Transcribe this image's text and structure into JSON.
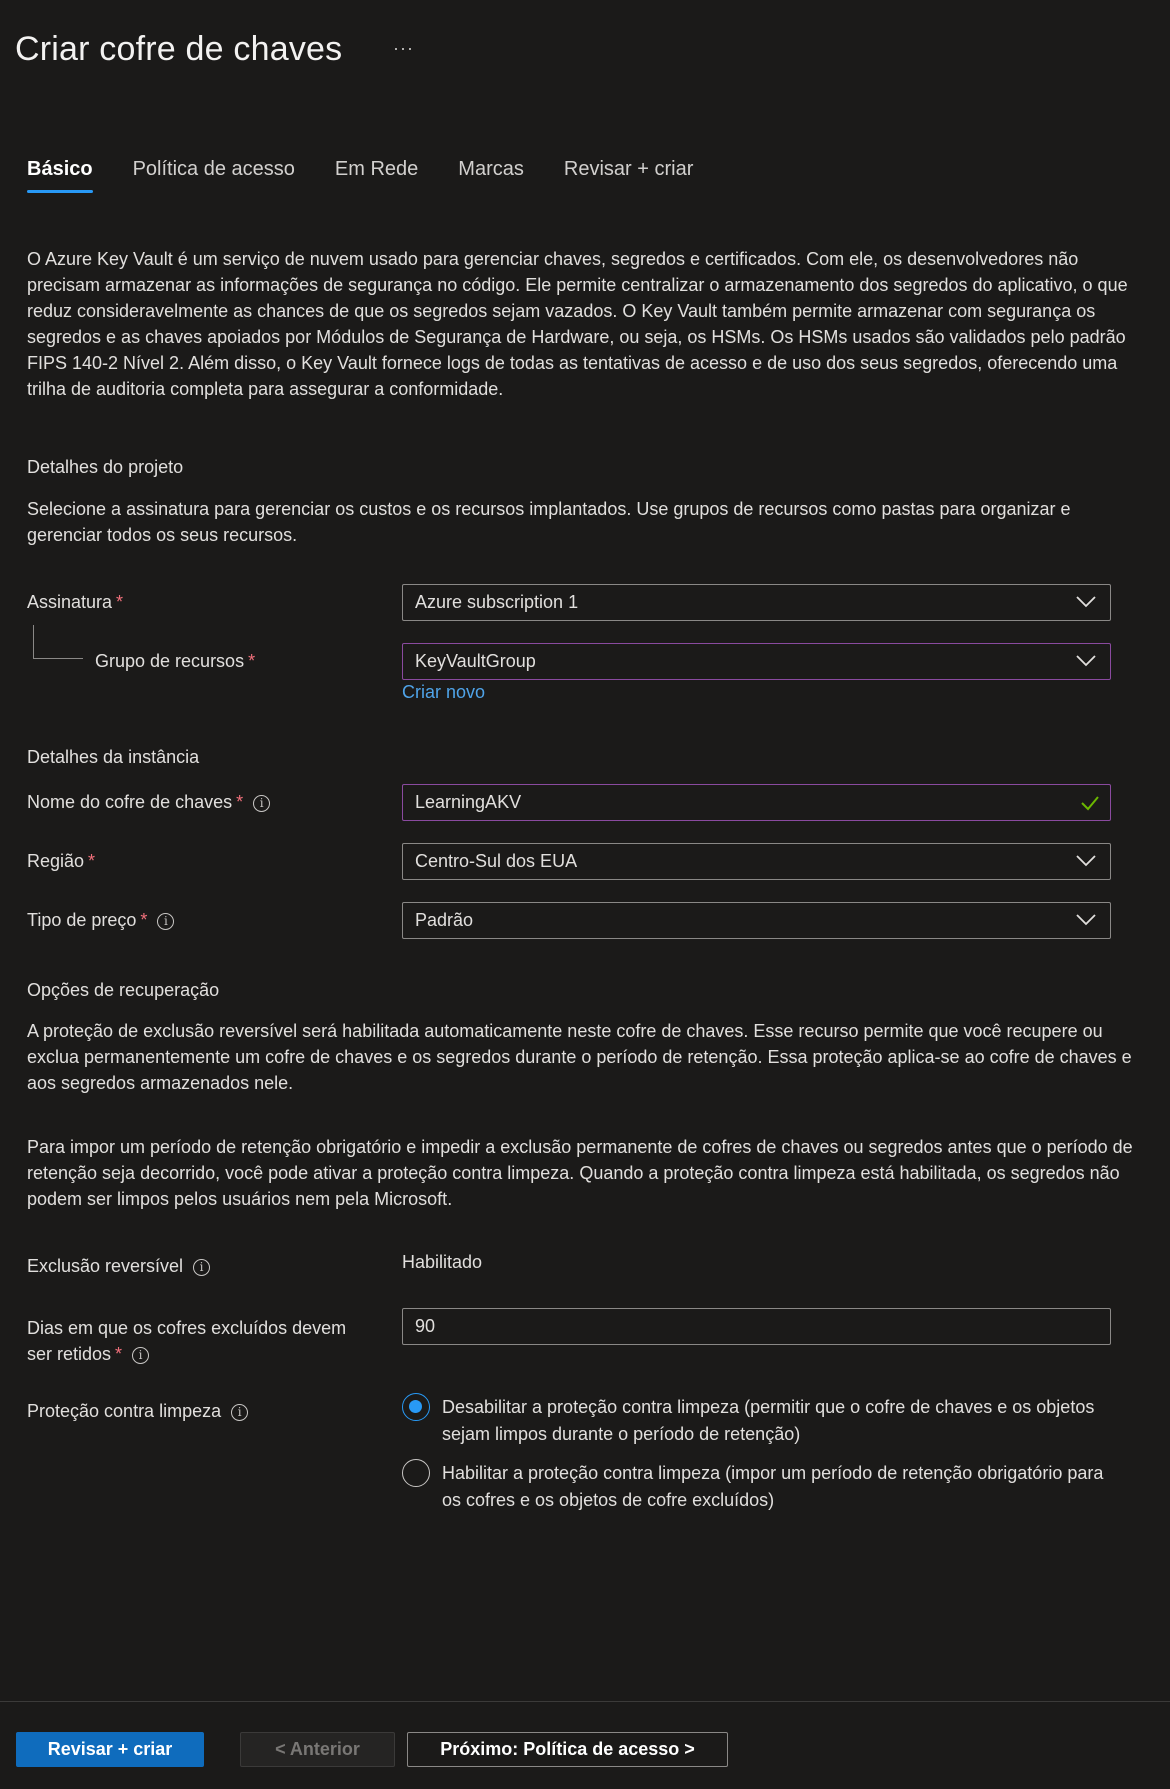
{
  "header": {
    "title": "Criar cofre de chaves",
    "more_icon": "ellipsis-icon"
  },
  "tabs": [
    {
      "label": "Básico",
      "active": true
    },
    {
      "label": "Política de acesso",
      "active": false
    },
    {
      "label": "Em Rede",
      "active": false
    },
    {
      "label": "Marcas",
      "active": false
    },
    {
      "label": "Revisar + criar",
      "active": false
    }
  ],
  "intro": "O Azure Key Vault é um serviço de nuvem usado para gerenciar chaves, segredos e certificados. Com ele, os desenvolvedores não precisam armazenar as informações de segurança no código. Ele permite centralizar o armazenamento dos segredos do aplicativo, o que reduz consideravelmente as chances de que os segredos sejam vazados. O Key Vault também permite armazenar com segurança os segredos e as chaves apoiados por Módulos de Segurança de Hardware, ou seja, os HSMs. Os HSMs usados são validados pelo padrão FIPS 140-2 Nível 2. Além disso, o Key Vault fornece logs de todas as tentativas de acesso e de uso dos seus segredos, oferecendo uma trilha de auditoria completa para assegurar a conformidade.",
  "project": {
    "heading": "Detalhes do projeto",
    "description": "Selecione a assinatura para gerenciar os custos e os recursos implantados. Use grupos de recursos como pastas para organizar e gerenciar todos os seus recursos.",
    "subscription_label": "Assinatura",
    "subscription_value": "Azure subscription 1",
    "resource_group_label": "Grupo de recursos",
    "resource_group_value": "KeyVaultGroup",
    "create_new_link": "Criar novo"
  },
  "instance": {
    "heading": "Detalhes da instância",
    "name_label": "Nome do cofre de chaves",
    "name_value": "LearningAKV",
    "region_label": "Região",
    "region_value": "Centro-Sul dos EUA",
    "pricing_label": "Tipo de preço",
    "pricing_value": "Padrão"
  },
  "recovery": {
    "heading": "Opções de recuperação",
    "paragraph1": "A proteção de exclusão reversível será habilitada automaticamente neste cofre de chaves. Esse recurso permite que você recupere ou exclua permanentemente um cofre de chaves e os segredos durante o período de retenção. Essa proteção aplica-se ao cofre de chaves e aos segredos armazenados nele.",
    "paragraph2": "Para impor um período de retenção obrigatório e impedir a exclusão permanente de cofres de chaves ou segredos antes que o período de retenção seja decorrido, você pode ativar a proteção contra limpeza. Quando a proteção contra limpeza está habilitada, os segredos não podem ser limpos pelos usuários nem pela Microsoft.",
    "soft_delete_label": "Exclusão reversível",
    "soft_delete_value": "Habilitado",
    "retention_label_line1": "Dias em que os cofres excluídos devem",
    "retention_label_line2": "ser retidos",
    "retention_value": "90",
    "purge_label": "Proteção contra limpeza",
    "purge_options": [
      {
        "label": "Desabilitar a proteção contra limpeza (permitir que o cofre de chaves e os objetos sejam limpos durante o período de retenção)",
        "checked": true
      },
      {
        "label": "Habilitar a proteção contra limpeza (impor um período de retenção obrigatório para os cofres e os objetos de cofre excluídos)",
        "checked": false
      }
    ]
  },
  "footer": {
    "review_create": "Revisar + criar",
    "previous": "< Anterior",
    "next": "Próximo: Política de acesso >"
  },
  "colors": {
    "background": "#1b1a19",
    "accent": "#2899f5",
    "primary_button": "#0f6cbd",
    "required": "#f1707b",
    "link": "#4fa3e8",
    "valid_check": "#6bb700",
    "focus_border": "#8a4a9f"
  }
}
